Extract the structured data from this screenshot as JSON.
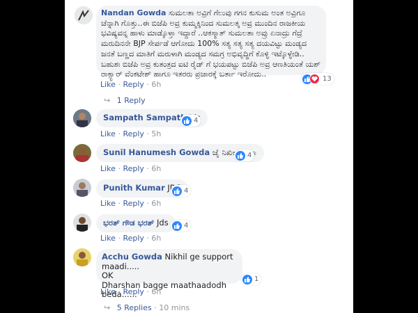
{
  "comments": [
    {
      "name": "Nandan Gowda",
      "text": "ಸುಮಲತಾ ಅವ್ರಿಗೆ ಗೆಲುವು ಗಗನ ಕುಸುಮ ಅಂತ ಅವ್ರಿಗೂ ಚೆನ್ನಾಗಿ ಗೊತ್ತು..ಈ ಬಿಜೆಪಿ ಅವ್ರ ಕುಮ್ಮಕ್ಕಿನಿಂದ ಸುಮಲತ್ಕ ಅವ್ರ ಮುಂದಿನ ರಾಜಕೀಯ ಭವಿಷ್ಯವನ್ನ ಹಾಳು ಮಾಡ್ಕೊಳ್ತಾ ಇದ್ದಾರೆ ..ಆಕಸ್ಮಾತ್ ಸುಮಲತಾ ಅವ್ರು ಏನಾದ್ರು ಗೆದ್ರೆ ಮರುದಿನನೇ BJP ಸೇರ್ಪಡೆ ಆಗೋದು 100% ಸತ್ಯ ಸತ್ಯ ಸತ್ಯ ದಯವಿಟ್ಟು ಮಂಡ್ಯದ ಜನತೆ ಬಣ್ಣದ ಮಾತಿಗೆ ಮರುಳಾಗಿ ಮಂಡ್ಯದ ಸಮಗ್ರ ಅಭಿವೃದ್ಧಿಗೆ ಕೊಳ್ಳಿ ಇಟ್ಕೊಳ್ಳೇಡಿ.. ಬಹುಶಃ ಬಿಜೆಪಿ ಅವ್ರ ಕುತಂತ್ರದ ಐಟಿ ರೈಡ್ ಗೆ ಭಯಪಟ್ಟು ಬಿಜೆಪಿ ಅವ್ರ ಆಣತಿಯಂತೆ ಯಶ್ ರಾಕ್ಸ್ಟಾರ್ ವೆಂಕಟೇಶ್ ಹಾಗೂ ಇತರರು ಪ್ರಚಾರಕ್ಕೆ ಬರ್ತಾ ಇರೋದು..",
      "like": "Like",
      "reply": "Reply",
      "time": "6h",
      "reactions": "13",
      "replies_link": "1 Reply"
    },
    {
      "name": "Sampath Sampath",
      "text": "Jds",
      "like": "Like",
      "reply": "Reply",
      "time": "5h",
      "reactions": "4"
    },
    {
      "name": "Sunil Hanumesh Gowda",
      "text": "ಜೈ ನಿಖಿಲ್ ಅಣ್ಣಾ",
      "like": "Like",
      "reply": "Reply",
      "time": "6h",
      "reactions": "4"
    },
    {
      "name": "Punith Kumar",
      "text": "JDS",
      "like": "Like",
      "reply": "Reply",
      "time": "6h",
      "reactions": "4"
    },
    {
      "name": "ಭರತ್ ಗೌಡ ಭರತ್",
      "text": "Jds",
      "like": "Like",
      "reply": "Reply",
      "time": "6h",
      "reactions": "4"
    },
    {
      "name": "Acchu Gowda",
      "line1": "Nikhil ge support maadi.....",
      "line2": "OK",
      "line3": "Dharshan bagge maathaadodh beda......",
      "like": "Like",
      "reply": "Reply",
      "time": "6h",
      "reactions": "1",
      "replies_link": "5 Replies",
      "replies_time": "10 mins"
    }
  ],
  "colors": {
    "link": "#365899",
    "bubble": "#f2f3f5",
    "like": "#2d88ff",
    "love": "#f0284a"
  },
  "icons": [
    "like-icon",
    "love-icon",
    "reply-arrow-icon"
  ]
}
